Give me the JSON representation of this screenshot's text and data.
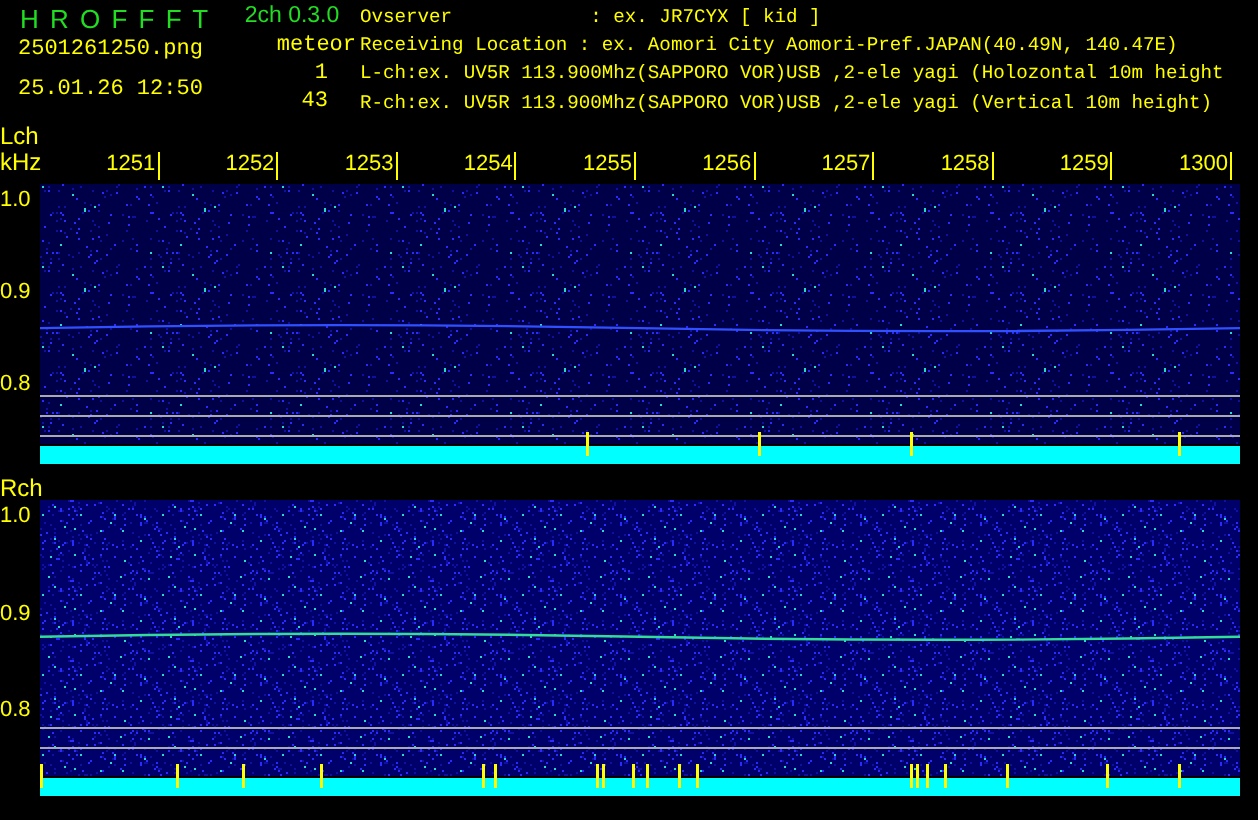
{
  "header": {
    "app_name": "H R O F F F T",
    "version": "2ch 0.3.0",
    "filename": "2501261250.png",
    "datetime": "25.01.26 12:50",
    "meteor_label": "meteor",
    "meteor_counts": [
      "1",
      "43"
    ],
    "info_lines": [
      "Ovserver            : ex. JR7CYX [ kid ]",
      "Receiving Location : ex. Aomori City Aomori-Pref.JAPAN(40.49N, 140.47E)",
      "L-ch:ex. UV5R 113.900Mhz(SAPPORO VOR)USB ,2-ele yagi (Holozontal 10m height",
      "R-ch:ex. UV5R 113.900Mhz(SAPPORO VOR)USB ,2-ele yagi (Vertical 10m height)"
    ]
  },
  "time_axis": {
    "ticks": [
      "1251",
      "1252",
      "1253",
      "1254",
      "1255",
      "1256",
      "1257",
      "1258",
      "1259",
      "1300"
    ]
  },
  "channels": [
    {
      "name": "Lch",
      "unit": "kHz",
      "freq_labels": [
        "1.0",
        "0.9",
        "0.8"
      ]
    },
    {
      "name": "Rch",
      "freq_labels": [
        "1.0",
        "0.9",
        "0.8"
      ]
    }
  ]
}
